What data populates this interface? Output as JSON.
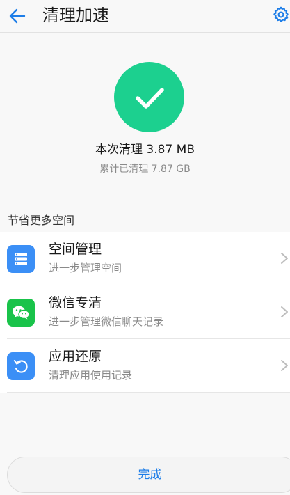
{
  "header": {
    "title": "清理加速",
    "back_icon": "arrow-left-icon",
    "settings_icon": "gear-icon"
  },
  "result": {
    "check_icon": "checkmark-icon",
    "cleaned_text": "本次清理 3.87 MB",
    "total_text": "累计已清理 7.87 GB"
  },
  "section": {
    "title": "节省更多空间"
  },
  "items": [
    {
      "title": "空间管理",
      "subtitle": "进一步管理空间",
      "icon": "storage-list-icon",
      "icon_color": "#3b8ff6"
    },
    {
      "title": "微信专清",
      "subtitle": "进一步管理微信聊天记录",
      "icon": "wechat-icon",
      "icon_color": "#19c34a"
    },
    {
      "title": "应用还原",
      "subtitle": "清理应用使用记录",
      "icon": "restore-icon",
      "icon_color": "#3b8ff6"
    }
  ],
  "footer": {
    "done_label": "完成"
  },
  "colors": {
    "accent": "#1e7ee8",
    "success": "#1cd08f"
  }
}
